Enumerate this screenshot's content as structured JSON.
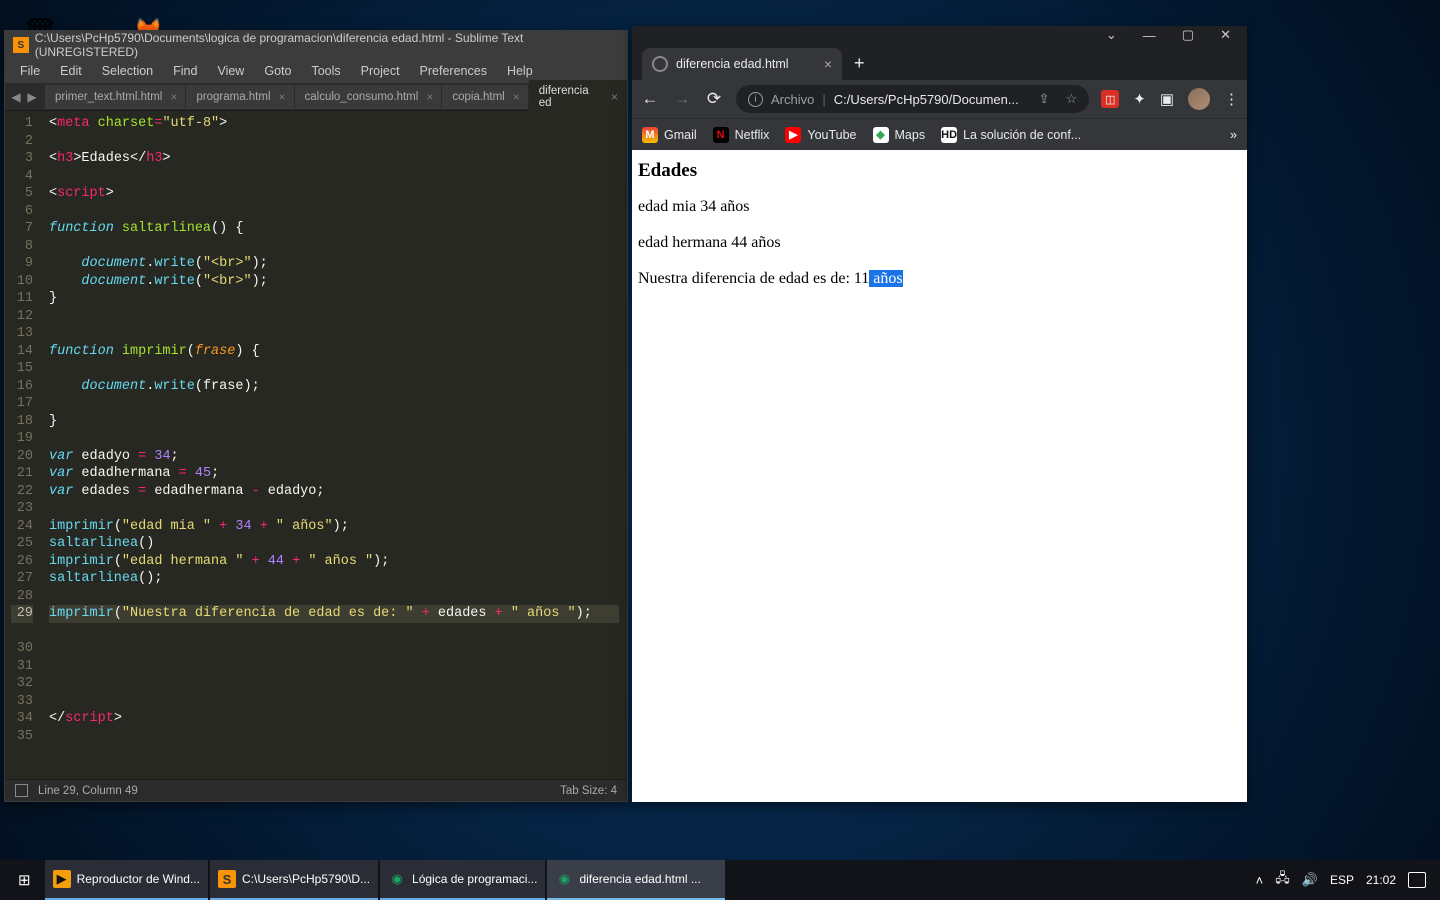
{
  "desktop": {
    "icons": [
      "🗑",
      "🦊"
    ]
  },
  "sublime": {
    "title": "C:\\Users\\PcHp5790\\Documents\\logica de programacion\\diferencia edad.html - Sublime Text (UNREGISTERED)",
    "menu": [
      "File",
      "Edit",
      "Selection",
      "Find",
      "View",
      "Goto",
      "Tools",
      "Project",
      "Preferences",
      "Help"
    ],
    "tabs": [
      {
        "label": "primer_text.html.html",
        "active": false
      },
      {
        "label": "programa.html",
        "active": false
      },
      {
        "label": "calculo_consumo.html",
        "active": false
      },
      {
        "label": "copia.html",
        "active": false
      },
      {
        "label": "diferencia ed",
        "active": true
      }
    ],
    "line_count": 35,
    "highlight_line": 29,
    "status_left": "Line 29, Column 49",
    "status_right": "Tab Size: 4",
    "code_tokens": {
      "l1a": "<",
      "l1b": "meta ",
      "l1c": "charset",
      "l1d": "=",
      "l1e": "\"utf-8\"",
      "l1f": ">",
      "l3a": "<",
      "l3b": "h3",
      "l3c": ">",
      "l3d": "Edades",
      "l3e": "</",
      "l3f": "h3",
      "l3g": ">",
      "l5a": "<",
      "l5b": "script",
      "l5c": ">",
      "l7a": "function",
      "l7b": " ",
      "l7c": "saltarlinea",
      "l7d": "() {",
      "l9a": "    ",
      "l9b": "document",
      "l9c": ".",
      "l9d": "write",
      "l9e": "(",
      "l9f": "\"<br>\"",
      "l9g": ");",
      "l10a": "    ",
      "l10b": "document",
      "l10c": ".",
      "l10d": "write",
      "l10e": "(",
      "l10f": "\"<br>\"",
      "l10g": ");",
      "l11a": "}",
      "l14a": "function",
      "l14b": " ",
      "l14c": "imprimir",
      "l14d": "(",
      "l14e": "frase",
      "l14f": ") {",
      "l16a": "    ",
      "l16b": "document",
      "l16c": ".",
      "l16d": "write",
      "l16e": "(",
      "l16f": "frase",
      "l16g": ");",
      "l18a": "}",
      "l20a": "var",
      "l20b": " edadyo ",
      "l20c": "=",
      "l20d": " ",
      "l20e": "34",
      "l20f": ";",
      "l21a": "var",
      "l21b": " edadhermana ",
      "l21c": "=",
      "l21d": " ",
      "l21e": "45",
      "l21f": ";",
      "l22a": "var",
      "l22b": " edades ",
      "l22c": "=",
      "l22d": " edadhermana ",
      "l22e": "-",
      "l22f": " edadyo;",
      "l24a": "imprimir",
      "l24b": "(",
      "l24c": "\"edad mia \"",
      "l24d": " ",
      "l24e": "+",
      "l24f": " ",
      "l24g": "34",
      "l24h": " ",
      "l24i": "+",
      "l24j": " ",
      "l24k": "\" años\"",
      "l24l": ");",
      "l25a": "saltarlinea",
      "l25b": "()",
      "l26a": "imprimir",
      "l26b": "(",
      "l26c": "\"edad hermana \"",
      "l26d": " ",
      "l26e": "+",
      "l26f": " ",
      "l26g": "44",
      "l26h": " ",
      "l26i": "+",
      "l26j": " ",
      "l26k": "\" años \"",
      "l26l": ");",
      "l27a": "saltarlinea",
      "l27b": "();",
      "l29a": "imprimir",
      "l29b": "(",
      "l29c": "\"Nuestra diferencia de edad es de: \"",
      "l29d": " ",
      "l29e": "+",
      "l29f": " edades ",
      "l29g": "+",
      "l29h": " ",
      "l29i": "\" años \"",
      "l29j": ");",
      "l35a": "</",
      "l35b": "script",
      "l35c": ">"
    }
  },
  "chrome": {
    "tab_title": "diferencia edad.html",
    "addr_label": "Archivo",
    "addr_url": "C:/Users/PcHp5790/Documen...",
    "bookmarks": [
      {
        "icon": "M",
        "cls": "bi-gm",
        "label": "Gmail"
      },
      {
        "icon": "N",
        "cls": "bi-nf",
        "label": "Netflix"
      },
      {
        "icon": "▶",
        "cls": "bi-yt",
        "label": "YouTube"
      },
      {
        "icon": "◆",
        "cls": "bi-mp",
        "label": "Maps"
      },
      {
        "icon": "HD",
        "cls": "bi-hd",
        "label": "La solución de conf..."
      }
    ],
    "page": {
      "heading": "Edades",
      "line1": "edad mia 34 años",
      "line2": "edad hermana 44 años",
      "line3a": "Nuestra diferencia de edad es de: 11",
      "line3sel": " años"
    }
  },
  "taskbar": {
    "items": [
      {
        "icon": "▶",
        "color": "#f59e0b",
        "label": "Reproductor de Wind...",
        "active": false
      },
      {
        "icon": "S",
        "color": "#f89406",
        "label": "C:\\Users\\PcHp5790\\D...",
        "active": false
      },
      {
        "icon": "●",
        "color": "#1aa260",
        "label": "Lógica de programaci...",
        "active": false
      },
      {
        "icon": "●",
        "color": "#1aa260",
        "label": "diferencia edad.html ...",
        "active": true
      }
    ],
    "tray": {
      "lang": "ESP",
      "time": "21:02"
    }
  }
}
